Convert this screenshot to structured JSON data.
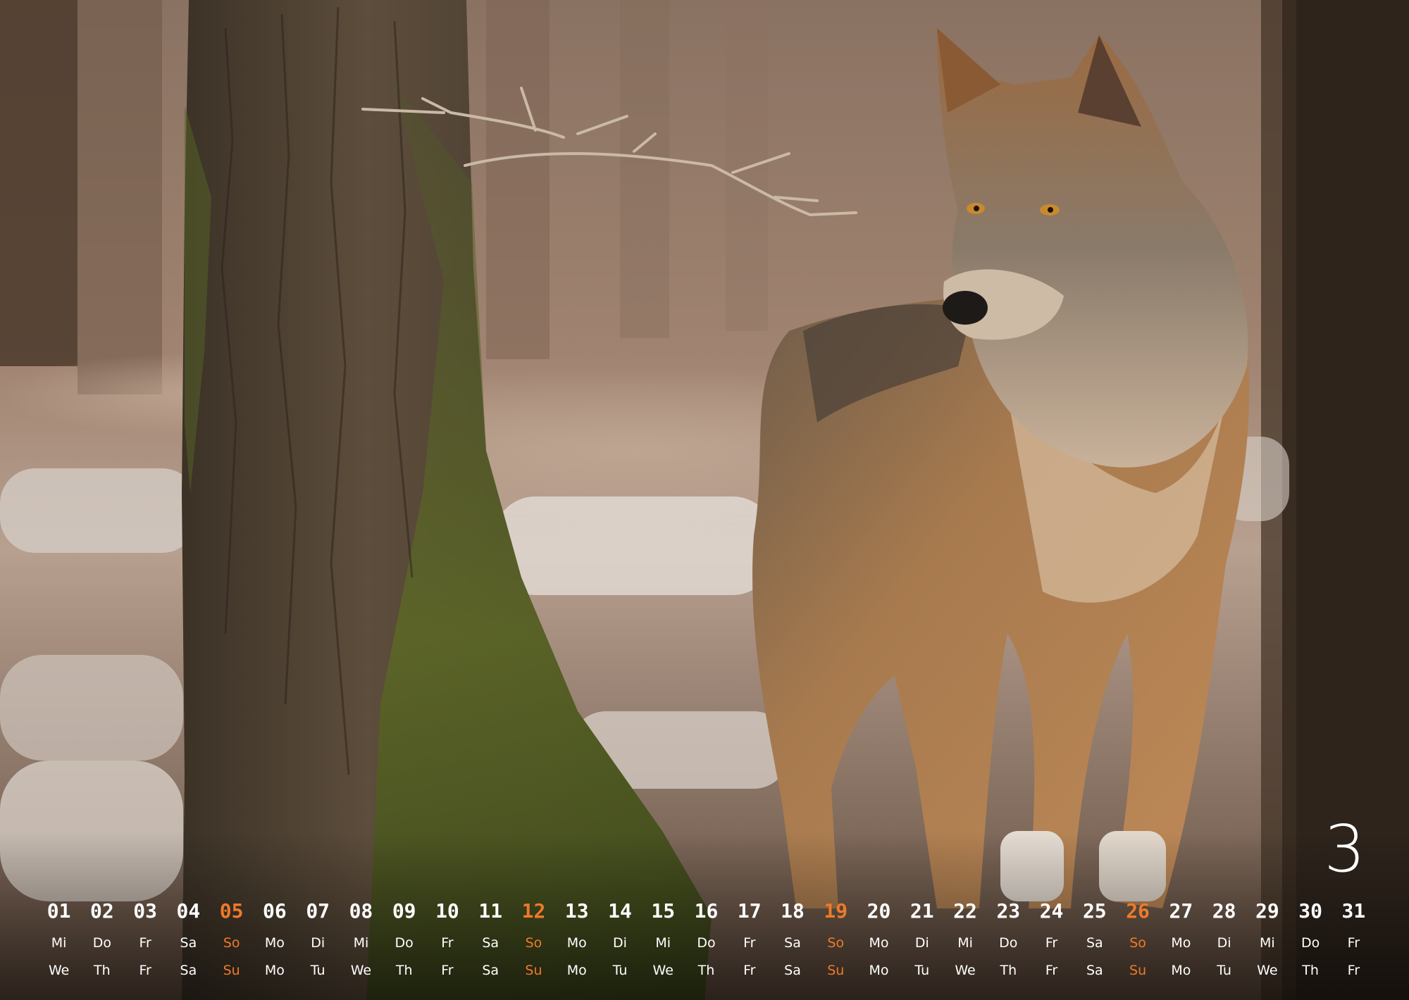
{
  "calendar": {
    "month": "3",
    "weekend_color": "#ee7a2a",
    "text_color": "#ffffff",
    "days": [
      {
        "num": "01",
        "de": "Mi",
        "en": "We",
        "sunday": false
      },
      {
        "num": "02",
        "de": "Do",
        "en": "Th",
        "sunday": false
      },
      {
        "num": "03",
        "de": "Fr",
        "en": "Fr",
        "sunday": false
      },
      {
        "num": "04",
        "de": "Sa",
        "en": "Sa",
        "sunday": false
      },
      {
        "num": "05",
        "de": "So",
        "en": "Su",
        "sunday": true
      },
      {
        "num": "06",
        "de": "Mo",
        "en": "Mo",
        "sunday": false
      },
      {
        "num": "07",
        "de": "Di",
        "en": "Tu",
        "sunday": false
      },
      {
        "num": "08",
        "de": "Mi",
        "en": "We",
        "sunday": false
      },
      {
        "num": "09",
        "de": "Do",
        "en": "Th",
        "sunday": false
      },
      {
        "num": "10",
        "de": "Fr",
        "en": "Fr",
        "sunday": false
      },
      {
        "num": "11",
        "de": "Sa",
        "en": "Sa",
        "sunday": false
      },
      {
        "num": "12",
        "de": "So",
        "en": "Su",
        "sunday": true
      },
      {
        "num": "13",
        "de": "Mo",
        "en": "Mo",
        "sunday": false
      },
      {
        "num": "14",
        "de": "Di",
        "en": "Tu",
        "sunday": false
      },
      {
        "num": "15",
        "de": "Mi",
        "en": "We",
        "sunday": false
      },
      {
        "num": "16",
        "de": "Do",
        "en": "Th",
        "sunday": false
      },
      {
        "num": "17",
        "de": "Fr",
        "en": "Fr",
        "sunday": false
      },
      {
        "num": "18",
        "de": "Sa",
        "en": "Sa",
        "sunday": false
      },
      {
        "num": "19",
        "de": "So",
        "en": "Su",
        "sunday": true
      },
      {
        "num": "20",
        "de": "Mo",
        "en": "Mo",
        "sunday": false
      },
      {
        "num": "21",
        "de": "Di",
        "en": "Tu",
        "sunday": false
      },
      {
        "num": "22",
        "de": "Mi",
        "en": "We",
        "sunday": false
      },
      {
        "num": "23",
        "de": "Do",
        "en": "Th",
        "sunday": false
      },
      {
        "num": "24",
        "de": "Fr",
        "en": "Fr",
        "sunday": false
      },
      {
        "num": "25",
        "de": "Sa",
        "en": "Sa",
        "sunday": false
      },
      {
        "num": "26",
        "de": "So",
        "en": "Su",
        "sunday": true
      },
      {
        "num": "27",
        "de": "Mo",
        "en": "Mo",
        "sunday": false
      },
      {
        "num": "28",
        "de": "Di",
        "en": "Tu",
        "sunday": false
      },
      {
        "num": "29",
        "de": "Mi",
        "en": "We",
        "sunday": false
      },
      {
        "num": "30",
        "de": "Do",
        "en": "Th",
        "sunday": false
      },
      {
        "num": "31",
        "de": "Fr",
        "en": "Fr",
        "sunday": false
      }
    ]
  }
}
